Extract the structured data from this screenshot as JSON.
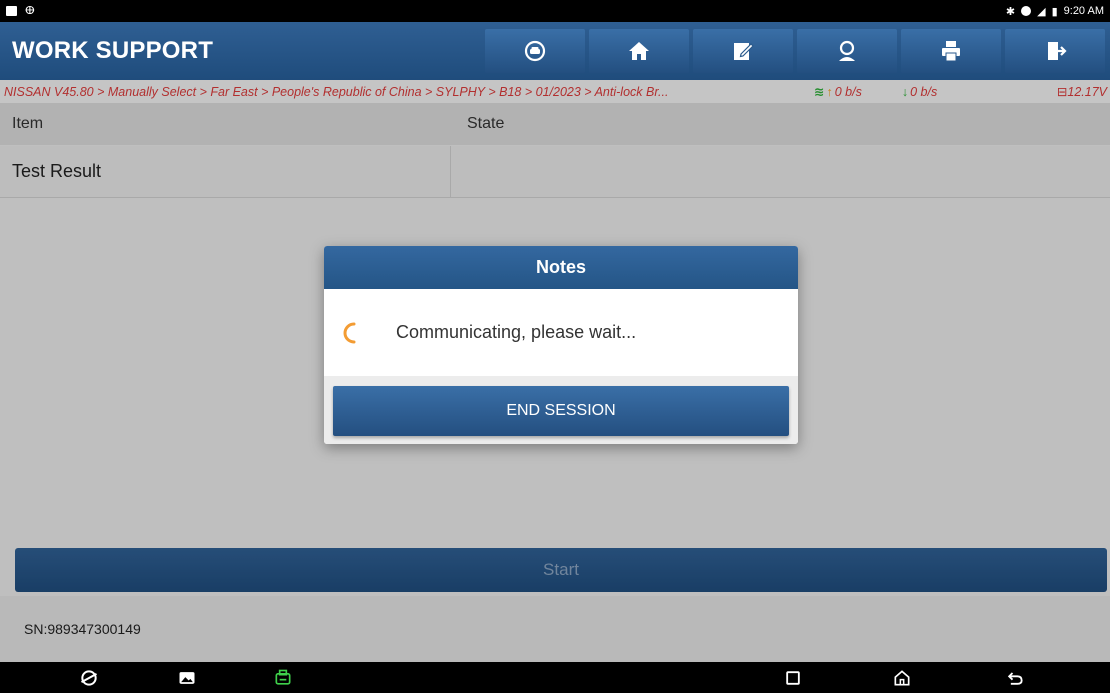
{
  "status_bar": {
    "time": "9:20 AM"
  },
  "header": {
    "title": "WORK SUPPORT",
    "toolbar": [
      {
        "icon": "car-diagnostic-icon"
      },
      {
        "icon": "home-icon"
      },
      {
        "icon": "report-edit-icon"
      },
      {
        "icon": "support-person-icon"
      },
      {
        "icon": "print-icon"
      },
      {
        "icon": "exit-icon"
      }
    ]
  },
  "breadcrumb": {
    "path": "NISSAN V45.80 > Manually Select > Far East > People's Republic of China > SYLPHY > B18 > 01/2023 > Anti-lock Br...",
    "upload_rate": "0 b/s",
    "download_rate": "0 b/s",
    "voltage": "12.17V"
  },
  "table": {
    "headers": [
      "Item",
      "State"
    ],
    "rows": [
      {
        "item": "Test Result",
        "state": ""
      }
    ]
  },
  "start_button": "Start",
  "footer": {
    "serial": "SN:989347300149"
  },
  "dialog": {
    "title": "Notes",
    "message": "Communicating, please wait...",
    "button": "END SESSION"
  },
  "colors": {
    "header_blue": "#2a5a8c",
    "breadcrumb_red": "#d93a3a",
    "spinner_orange": "#f39c33"
  }
}
